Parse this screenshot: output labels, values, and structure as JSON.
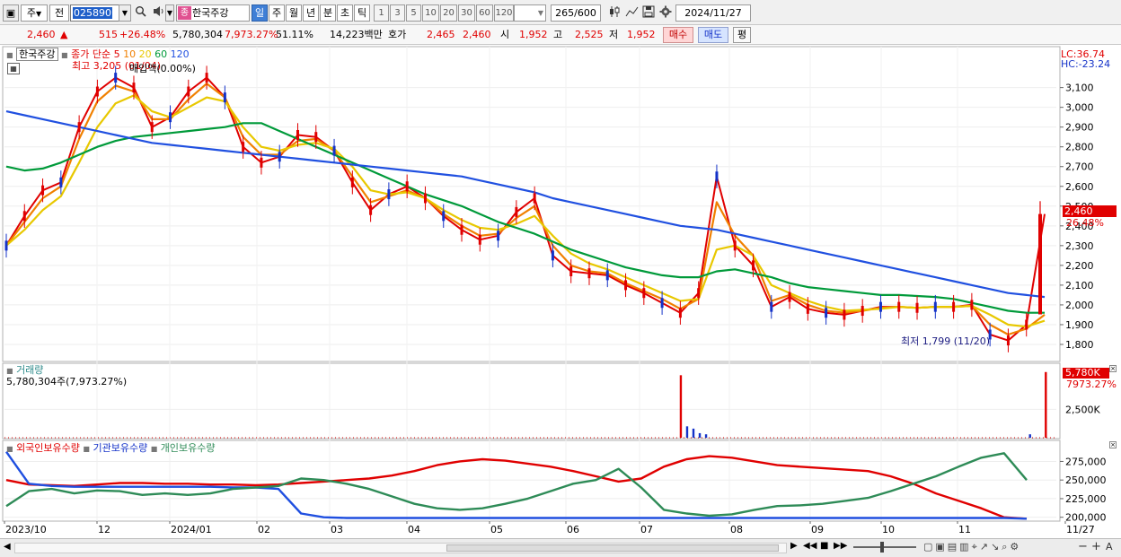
{
  "toolbar": {
    "period_type": "주",
    "prev_label": "전",
    "code": "025890",
    "stock_name": "한국주강",
    "stock_badge": "종",
    "period_tabs": [
      "일",
      "주",
      "월",
      "년",
      "분",
      "초",
      "틱"
    ],
    "active_period": "일",
    "minute_options": [
      "1",
      "3",
      "5",
      "10",
      "20",
      "30",
      "60",
      "120"
    ],
    "bar_count": "265",
    "bar_total": "/600",
    "date": "2024/11/27"
  },
  "quote": {
    "price": "2,460",
    "change_arrow": "▲",
    "change": "515",
    "change_pct": "+26.48%",
    "volume": "5,780,304",
    "volume_ratio": "7,973.27%",
    "ratio2": "51.11%",
    "amount": "14,223백만",
    "hoga_label": "호가",
    "bid": "2,465",
    "ask": "2,460",
    "open_label": "시",
    "open": "1,952",
    "high_label": "고",
    "high": "2,525",
    "low_label": "저",
    "low": "1,952",
    "buy_label": "매수",
    "sell_label": "매도",
    "avg_label": "평"
  },
  "price_panel": {
    "title": "한국주강",
    "ma_title": "종가 단순",
    "ma_periods": [
      "5",
      "10",
      "20",
      "60",
      "120"
    ],
    "ma_colors": [
      "#e00000",
      "#f08000",
      "#e8c800",
      "#009a3a",
      "#2050e0"
    ],
    "high_note": "최고 3,205 (01/04)",
    "overlay_note": "매입액(0.00%)",
    "low_note": "최저 1,799 (11/20)",
    "lc_label": "LC:36.74",
    "hc_label": "HC:-23.24",
    "price_tag": "2,460",
    "pct_tag": "26.48%",
    "y_ticks": [
      "3,100",
      "3,000",
      "2,900",
      "2,800",
      "2,700",
      "2,600",
      "2,500",
      "2,400",
      "2,300",
      "2,200",
      "2,100",
      "2,000",
      "1,900",
      "1,800"
    ]
  },
  "volume_panel": {
    "title": "거래량",
    "value_text": "5,780,304주(7,973.27%)",
    "tag": "5,780K",
    "tag_pct": "7973.27%",
    "y_tick": "2,500K"
  },
  "holding_panel": {
    "titles": [
      "외국인보유수량",
      "기관보유수량",
      "개인보유수량"
    ],
    "colors": [
      "#e00000",
      "#1f4fe0",
      "#2e8b57"
    ],
    "y_ticks": [
      "275,000",
      "250,000",
      "225,000",
      "200,000"
    ]
  },
  "x_axis": {
    "labels": [
      "2023/10",
      "12",
      "2024/01",
      "02",
      "03",
      "04",
      "05",
      "06",
      "07",
      "08",
      "09",
      "10",
      "11",
      "11/27"
    ]
  },
  "chart_data": [
    {
      "type": "line",
      "panel": "price",
      "ylim": [
        1750,
        3180
      ],
      "series": [
        {
          "name": "5",
          "values": [
            2300,
            2450,
            2580,
            2620,
            2900,
            3080,
            3150,
            3100,
            2900,
            2950,
            3080,
            3150,
            3050,
            2800,
            2720,
            2750,
            2860,
            2850,
            2780,
            2620,
            2480,
            2560,
            2600,
            2540,
            2450,
            2380,
            2330,
            2350,
            2470,
            2540,
            2250,
            2170,
            2160,
            2150,
            2100,
            2060,
            2010,
            1960,
            2060,
            2650,
            2300,
            2200,
            1990,
            2040,
            1980,
            1960,
            1950,
            1970,
            1990,
            1990,
            1985,
            1990,
            1990,
            2000,
            1850,
            1820,
            1900,
            2460
          ]
        },
        {
          "name": "10",
          "values": [
            2300,
            2420,
            2540,
            2600,
            2840,
            3030,
            3110,
            3080,
            2940,
            2940,
            3040,
            3120,
            3050,
            2850,
            2760,
            2760,
            2830,
            2840,
            2780,
            2650,
            2520,
            2550,
            2580,
            2540,
            2460,
            2400,
            2350,
            2360,
            2440,
            2500,
            2300,
            2200,
            2170,
            2160,
            2110,
            2070,
            2030,
            1980,
            2030,
            2520,
            2350,
            2250,
            2020,
            2050,
            2000,
            1970,
            1960,
            1970,
            1985,
            1990,
            1985,
            1990,
            1990,
            1995,
            1900,
            1850,
            1880,
            1950
          ]
        },
        {
          "name": "20",
          "values": [
            2300,
            2380,
            2480,
            2550,
            2720,
            2900,
            3020,
            3060,
            2980,
            2950,
            3000,
            3050,
            3030,
            2900,
            2800,
            2780,
            2810,
            2820,
            2790,
            2700,
            2580,
            2560,
            2570,
            2540,
            2480,
            2430,
            2390,
            2380,
            2410,
            2450,
            2350,
            2260,
            2210,
            2180,
            2140,
            2100,
            2060,
            2020,
            2030,
            2280,
            2300,
            2250,
            2100,
            2060,
            2020,
            1990,
            1970,
            1975,
            1980,
            1990,
            1985,
            1990,
            1990,
            1995,
            1950,
            1900,
            1890,
            1920
          ]
        },
        {
          "name": "60",
          "values": [
            2700,
            2680,
            2690,
            2720,
            2760,
            2800,
            2830,
            2850,
            2860,
            2870,
            2880,
            2890,
            2900,
            2920,
            2920,
            2880,
            2840,
            2800,
            2760,
            2720,
            2680,
            2640,
            2600,
            2560,
            2530,
            2500,
            2460,
            2420,
            2390,
            2360,
            2320,
            2280,
            2250,
            2220,
            2190,
            2170,
            2150,
            2140,
            2140,
            2170,
            2180,
            2160,
            2140,
            2110,
            2090,
            2080,
            2070,
            2060,
            2050,
            2050,
            2045,
            2040,
            2030,
            2010,
            1990,
            1970,
            1960,
            1960
          ]
        },
        {
          "name": "120",
          "values": [
            2980,
            2960,
            2940,
            2920,
            2900,
            2880,
            2860,
            2840,
            2820,
            2810,
            2800,
            2790,
            2780,
            2770,
            2760,
            2750,
            2740,
            2730,
            2720,
            2710,
            2700,
            2690,
            2680,
            2670,
            2660,
            2650,
            2630,
            2610,
            2590,
            2570,
            2540,
            2520,
            2500,
            2480,
            2460,
            2440,
            2420,
            2400,
            2390,
            2380,
            2360,
            2340,
            2320,
            2300,
            2280,
            2260,
            2240,
            2220,
            2200,
            2180,
            2160,
            2140,
            2120,
            2100,
            2080,
            2060,
            2050,
            2040
          ]
        }
      ]
    },
    {
      "type": "bar",
      "panel": "volume",
      "ylim": [
        0,
        6000
      ],
      "spikes": [
        {
          "t": 0.643,
          "v": 5500
        },
        {
          "t": 0.649,
          "v": 1000
        },
        {
          "t": 0.655,
          "v": 800
        },
        {
          "t": 0.661,
          "v": 400
        },
        {
          "t": 0.667,
          "v": 300
        },
        {
          "t": 0.975,
          "v": 300
        },
        {
          "t": 0.99,
          "v": 5780
        }
      ]
    },
    {
      "type": "line",
      "panel": "holdings",
      "ylim": [
        196000,
        290000
      ],
      "series": [
        {
          "name": "외국인보유수량",
          "values": [
            250000,
            244000,
            243000,
            242000,
            244000,
            246000,
            246000,
            245000,
            245000,
            244000,
            244000,
            243000,
            244000,
            246000,
            248000,
            250000,
            252000,
            256000,
            262000,
            270000,
            275000,
            278000,
            276000,
            272000,
            268000,
            262000,
            255000,
            248000,
            252000,
            268000,
            278000,
            282000,
            280000,
            275000,
            270000,
            268000,
            266000,
            264000,
            262000,
            255000,
            245000,
            232000,
            222000,
            212000,
            200000,
            198000
          ]
        },
        {
          "name": "기관보유수량",
          "values": [
            288000,
            245000,
            242000,
            241000,
            241000,
            241000,
            241000,
            241000,
            241000,
            241000,
            240000,
            240000,
            238000,
            205000,
            200000,
            199000,
            199000,
            199000,
            199000,
            199000,
            199000,
            199000,
            199000,
            199000,
            199000,
            199000,
            199000,
            199000,
            199000,
            199000,
            199000,
            199000,
            199000,
            199000,
            199000,
            199000,
            199000,
            199000,
            199000,
            199000,
            199000,
            199000,
            199000,
            199000,
            199000,
            198000
          ]
        },
        {
          "name": "개인보유수량",
          "values": [
            215000,
            235000,
            238000,
            232000,
            236000,
            235000,
            230000,
            232000,
            230000,
            232000,
            238000,
            240000,
            242000,
            252000,
            250000,
            245000,
            238000,
            228000,
            218000,
            212000,
            210000,
            212000,
            218000,
            225000,
            235000,
            245000,
            250000,
            265000,
            240000,
            210000,
            205000,
            202000,
            204000,
            210000,
            215000,
            216000,
            218000,
            222000,
            226000,
            235000,
            245000,
            255000,
            268000,
            280000,
            286000,
            250000
          ]
        }
      ]
    }
  ]
}
